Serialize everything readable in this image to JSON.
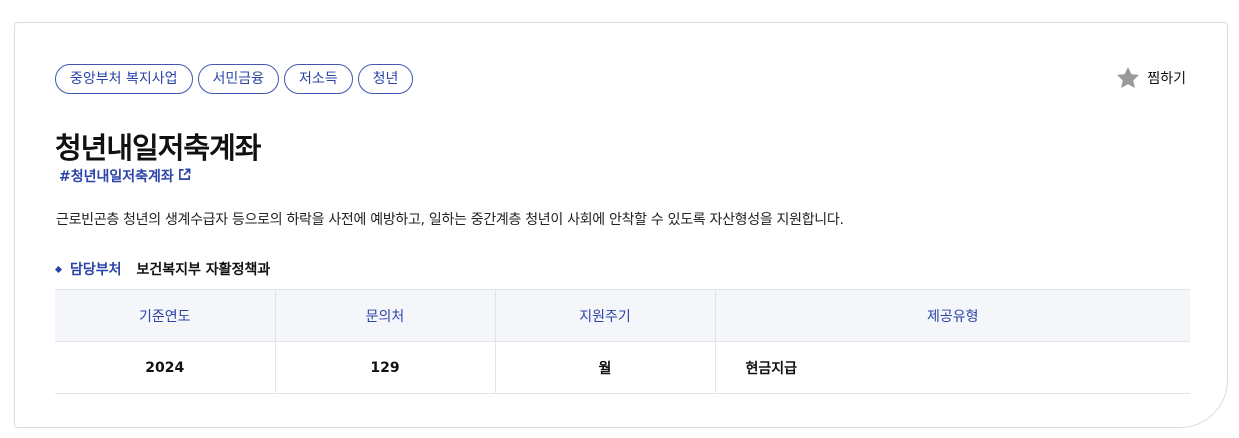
{
  "tags": [
    "중앙부처 복지사업",
    "서민금융",
    "저소득",
    "청년"
  ],
  "favorite": {
    "label": "찜하기",
    "icon": "star-icon",
    "icon_color": "#9a9a9a"
  },
  "title": "청년내일저축계좌",
  "hashtag": {
    "text": "#청년내일저축계좌",
    "icon": "external-link-icon"
  },
  "description": "근로빈곤층 청년의 생계수급자 등으로의 하락을 사전에 예방하고, 일하는 중간계층 청년이 사회에 안착할 수 있도록 자산형성을 지원합니다.",
  "department": {
    "label": "담당부처",
    "value": "보건복지부 자활정책과"
  },
  "table": {
    "headers": [
      "기준연도",
      "문의처",
      "지원주기",
      "제공유형"
    ],
    "row": [
      "2024",
      "129",
      "월",
      "현금지급"
    ]
  },
  "colors": {
    "accent": "#2b44a8",
    "header_bg": "#f4f6fa",
    "border": "#e1e4ec"
  }
}
